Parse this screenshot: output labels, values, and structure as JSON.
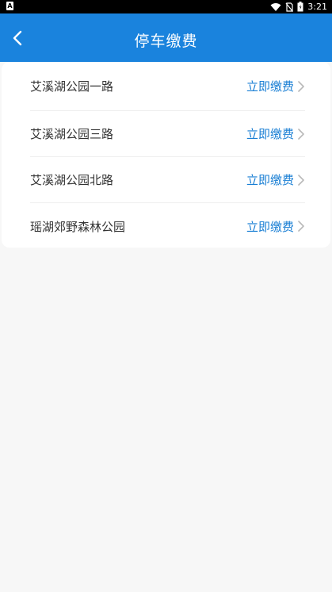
{
  "status_bar": {
    "app_icon_letter": "A",
    "time": "3:21"
  },
  "header": {
    "title": "停车缴费"
  },
  "parking_list": {
    "action_label": "立即缴费",
    "items": [
      {
        "name": "艾溪湖公园一路"
      },
      {
        "name": "艾溪湖公园三路"
      },
      {
        "name": "艾溪湖公园北路"
      },
      {
        "name": "瑶湖郊野森林公园"
      }
    ]
  },
  "colors": {
    "header_bg": "#1a83dd",
    "accent": "#1a7fd4",
    "page_bg": "#f7f7f7"
  }
}
